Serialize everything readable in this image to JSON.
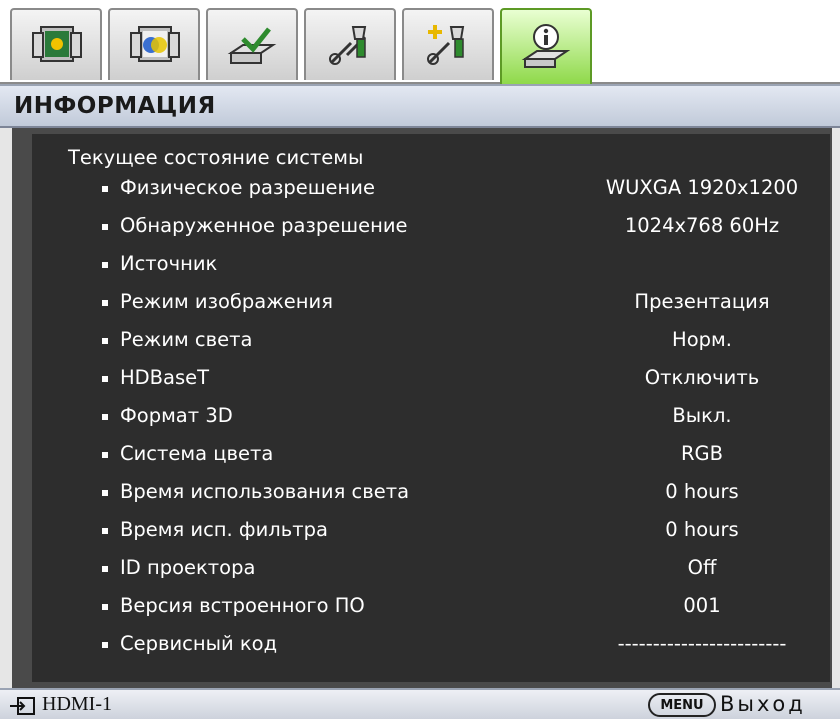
{
  "tabs": [
    {
      "icon": "picture-icon",
      "active": false
    },
    {
      "icon": "advanced-picture-icon",
      "active": false
    },
    {
      "icon": "display-settings-icon",
      "active": false
    },
    {
      "icon": "system-settings-icon",
      "active": false
    },
    {
      "icon": "advanced-settings-icon",
      "active": false
    },
    {
      "icon": "information-icon",
      "active": true
    }
  ],
  "header": {
    "title": "ИНФОРМАЦИЯ"
  },
  "status": {
    "title": "Текущее состояние системы",
    "rows": [
      {
        "label": "Физическое разрешение",
        "value": "WUXGA 1920x1200"
      },
      {
        "label": "Обнаруженное разрешение",
        "value": "1024x768 60Hz"
      },
      {
        "label": "Источник",
        "value": ""
      },
      {
        "label": "Режим изображения",
        "value": "Презентация"
      },
      {
        "label": "Режим света",
        "value": "Норм."
      },
      {
        "label": "HDBaseT",
        "value": "Отключить"
      },
      {
        "label": "Формат 3D",
        "value": "Выкл."
      },
      {
        "label": "Система цвета",
        "value": "RGB"
      },
      {
        "label": "Время использования света",
        "value": "0 hours"
      },
      {
        "label": "Время исп. фильтра",
        "value": "0 hours"
      },
      {
        "label": "ID проектора",
        "value": "Off"
      },
      {
        "label": "Версия встроенного ПО",
        "value": "001"
      },
      {
        "label": "Сервисный код",
        "value": "------------------------"
      }
    ]
  },
  "footer": {
    "source": "HDMI-1",
    "menu_key": "MENU",
    "exit": "Выход"
  },
  "colors": {
    "panel": "#2d2d2d",
    "active_tab": "#8fd94a",
    "header": "#c1cad9"
  }
}
